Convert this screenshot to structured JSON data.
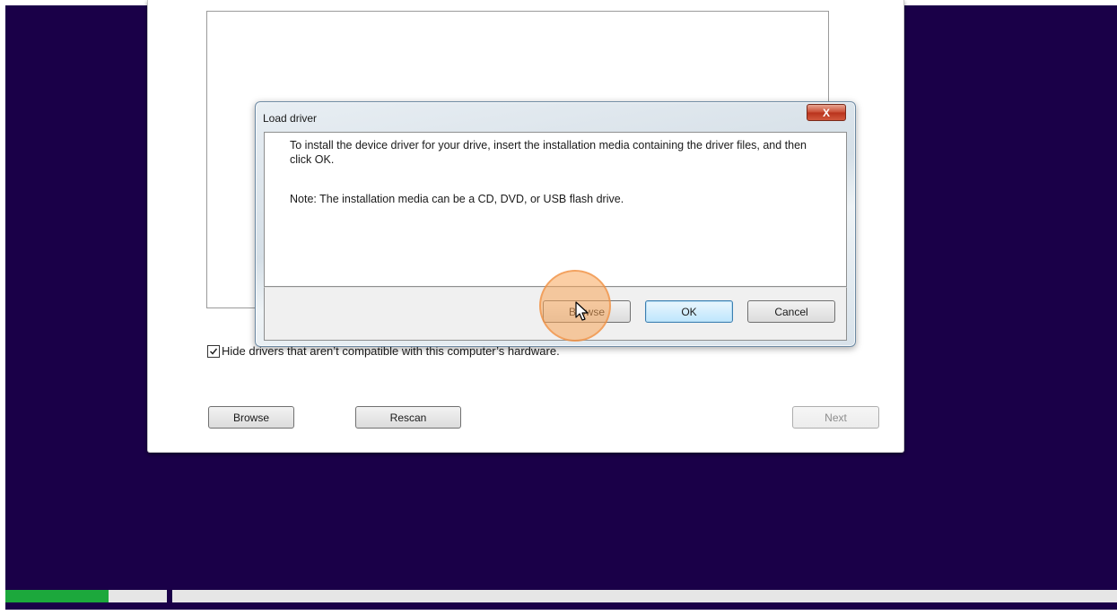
{
  "setup": {
    "hide_checkbox_checked": true,
    "hide_label": "Hide drivers that aren’t compatible with this computer’s hardware.",
    "browse_label": "Browse",
    "rescan_label": "Rescan",
    "next_label": "Next"
  },
  "dialog": {
    "title": "Load driver",
    "close_label": "X",
    "message": "To install the device driver for your drive, insert the installation media containing the driver files, and then click OK.",
    "note": "Note: The installation media can be a CD, DVD, or USB flash drive.",
    "browse_label": "Browse",
    "ok_label": "OK",
    "cancel_label": "Cancel"
  },
  "icons": {
    "checkbox": "check-icon",
    "cursor": "mouse-pointer-icon"
  },
  "colors": {
    "background": "#1a0048",
    "progress": "#1ca83c",
    "highlight": "#f7a65a"
  },
  "progress": {
    "stage1_fraction": 0.64,
    "stage2_fraction": 0.0
  }
}
